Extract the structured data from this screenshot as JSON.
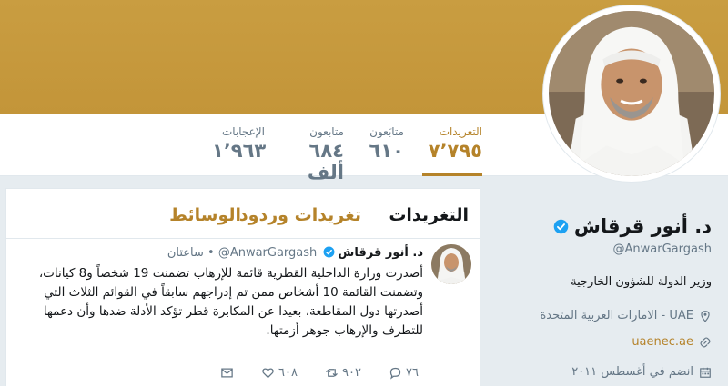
{
  "stats": [
    {
      "label": "التغريدات",
      "value": "٧٬٧٩٥",
      "active": true
    },
    {
      "label": "متابَعون",
      "value": "٦١٠",
      "active": false
    },
    {
      "label": "متابعون",
      "value": "٦٨٤ ألف",
      "active": false
    },
    {
      "label": "الإعجابات",
      "value": "١٬٩٦٣",
      "active": false
    }
  ],
  "tabs": {
    "tweets": "التغريدات",
    "replies": "تغريدات وردود",
    "media": "الوسائط"
  },
  "tweet": {
    "name": "د. أنور قرقاش",
    "handle": "@AnwarGargash",
    "separator": "•",
    "time": "ساعتان",
    "text": "أصدرت وزارة الداخلية القطرية قائمة للإرهاب تضمنت 19 شخصاً و8 كيانات، وتضمنت القائمة 10 أشخاص ممن تم إدراجهم سابقاً في القوائم الثلاث التي أصدرتها دول المقاطعة، بعيدا عن المكابرة قطر تؤكد الأدلة ضدها وأن دعمها للتطرف والإرهاب جوهر أزمتها.",
    "replies": "٧٦",
    "retweets": "٩٠٢",
    "likes": "٦٠٨"
  },
  "profile": {
    "name": "د. أنور قرقاش",
    "handle": "@AnwarGargash",
    "bio": "وزير الدولة للشؤون الخارجية",
    "location": "UAE - الامارات العربية المتحدة",
    "website": "uaenec.ae",
    "joined": "انضم في أغسطس ٢٠١١"
  },
  "colors": {
    "accent": "#b5832a",
    "banner": "#c69a3e",
    "background": "#e6ecf0",
    "verified": "#1da1f2"
  }
}
